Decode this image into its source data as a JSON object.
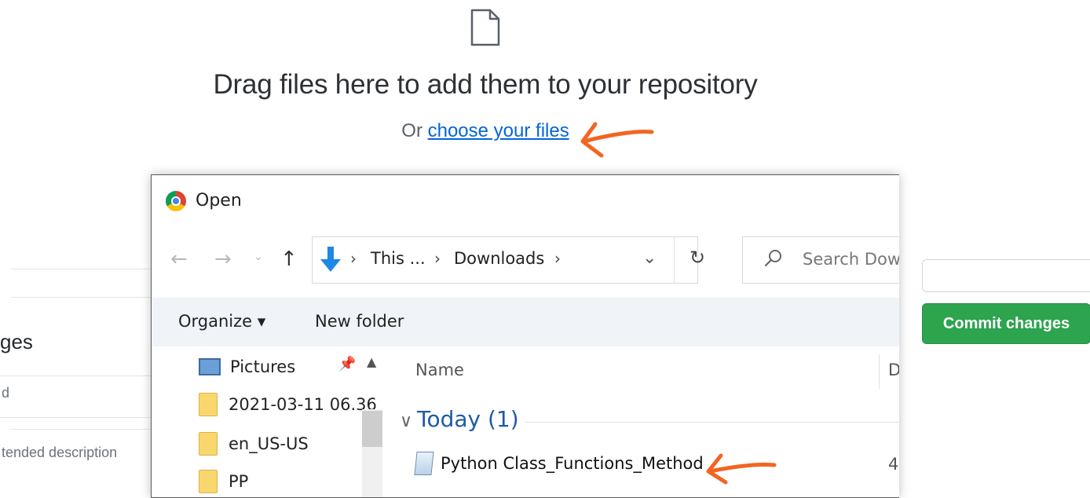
{
  "upload": {
    "title": "Drag files here to add them to your repository",
    "or_text": "Or ",
    "choose_link": "choose your files"
  },
  "background": {
    "changes_heading": "ges",
    "summary_text": "d",
    "description_text": "tended description",
    "commit_button": "Commit changes"
  },
  "dialog": {
    "title": "Open",
    "breadcrumb": [
      "This ...",
      "Downloads"
    ],
    "search_placeholder": "Search Dow",
    "toolbar": {
      "organize": "Organize ▾",
      "new_folder": "New folder"
    },
    "nav_items": [
      "Pictures",
      "2021-03-11 06.36",
      "en_US-US",
      "PP"
    ],
    "columns": {
      "name": "Name",
      "date": "D"
    },
    "group": "Today (1)",
    "file": {
      "name": "Python Class_Functions_Method",
      "date_trunc": "4"
    }
  },
  "colors": {
    "accent_link": "#0366d6",
    "commit_green": "#2da44e",
    "annotation": "#f26522",
    "group_blue": "#1e5aa8"
  },
  "icons": [
    "file-icon",
    "chrome-icon",
    "back-arrow-icon",
    "forward-arrow-icon",
    "up-arrow-icon",
    "download-arrow-icon",
    "refresh-icon",
    "search-icon",
    "pin-icon",
    "folder-icon",
    "pictures-icon",
    "doc-icon"
  ]
}
